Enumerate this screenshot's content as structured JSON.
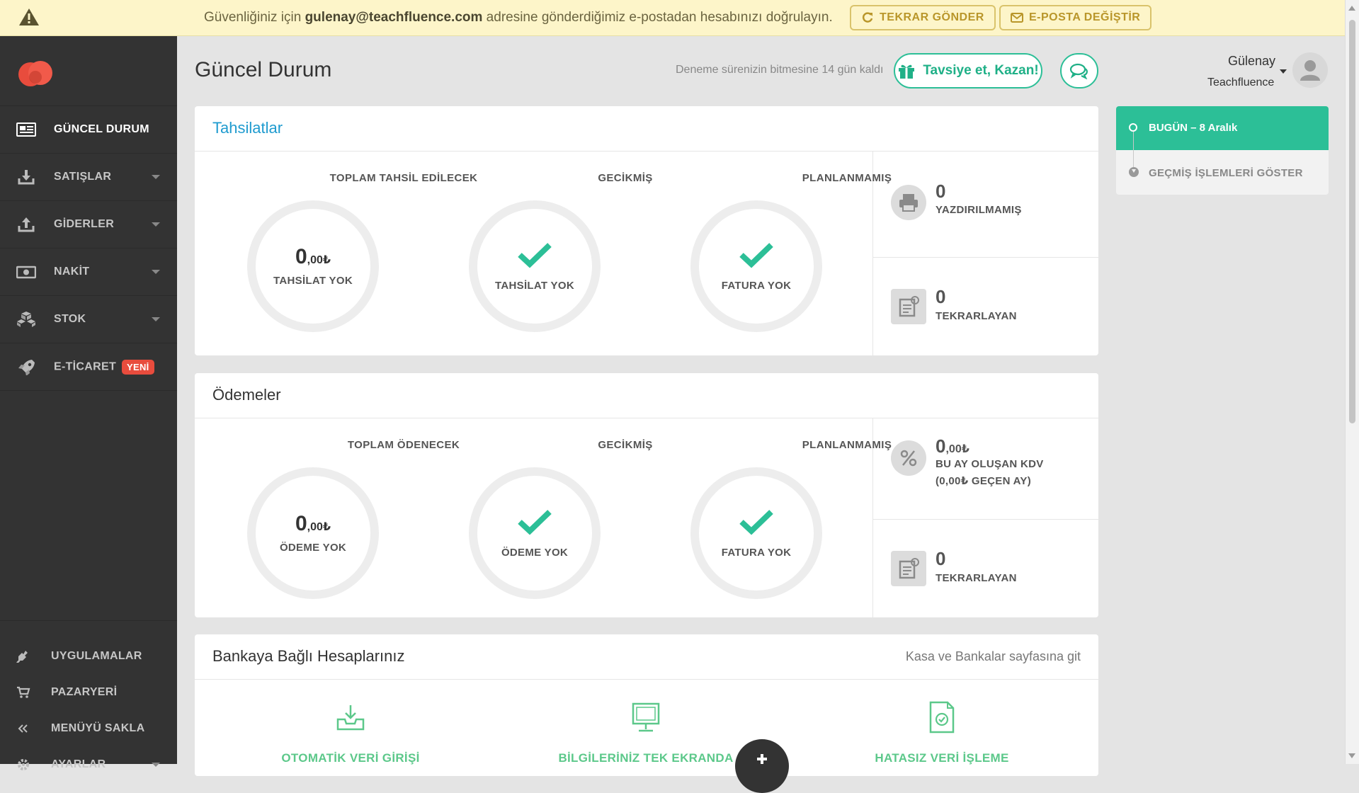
{
  "topbar": {
    "msg_pre": "Güvenliğiniz için ",
    "email": "gulenay@teachfluence.com",
    "msg_post": " adresine gönderdiğimiz e-postadan hesabınızı doğrulayın.",
    "resend_label": "TEKRAR GÖNDER",
    "change_email_label": "E-POSTA DEĞİŞTİR"
  },
  "sidebar": {
    "items": [
      {
        "label": "GÜNCEL DURUM",
        "icon": "newspaper-icon"
      },
      {
        "label": "SATIŞLAR",
        "icon": "download-tray-icon"
      },
      {
        "label": "GİDERLER",
        "icon": "upload-tray-icon"
      },
      {
        "label": "NAKİT",
        "icon": "banknote-icon"
      },
      {
        "label": "STOK",
        "icon": "boxes-icon"
      },
      {
        "label": "E-TİCARET",
        "icon": "rocket-icon",
        "badge": "YENİ"
      }
    ],
    "bottom": [
      {
        "label": "UYGULAMALAR",
        "icon": "plug-icon"
      },
      {
        "label": "PAZARYERİ",
        "icon": "cart-icon"
      },
      {
        "label": "MENÜYÜ SAKLA",
        "icon": "double-chevron-left-icon"
      },
      {
        "label": "AYARLAR",
        "icon": "gear-icon"
      }
    ]
  },
  "header": {
    "title": "Güncel Durum",
    "trial": "Deneme sürenizin bitmesine 14 gün kaldı",
    "refer_label": "Tavsiye et, Kazan!",
    "user_name": "Gülenay",
    "company": "Teachfluence"
  },
  "collections": {
    "title": "Tahsilatlar",
    "columns": [
      {
        "label": "TOPLAM TAHSİL EDİLECEK",
        "amount": "0",
        "decimal": ",00₺",
        "caption": "TAHSİLAT YOK"
      },
      {
        "label": "GECİKMİŞ",
        "caption": "TAHSİLAT YOK"
      },
      {
        "label": "PLANLANMAMIŞ",
        "caption": "FATURA YOK"
      }
    ],
    "side": [
      {
        "value": "0",
        "caption": "YAZDIRILMAMIŞ"
      },
      {
        "value": "0",
        "caption": "TEKRARLAYAN"
      }
    ]
  },
  "payments": {
    "title": "Ödemeler",
    "columns": [
      {
        "label": "TOPLAM ÖDENECEK",
        "amount": "0",
        "decimal": ",00₺",
        "caption": "ÖDEME YOK"
      },
      {
        "label": "GECİKMİŞ",
        "caption": "ÖDEME YOK"
      },
      {
        "label": "PLANLANMAMIŞ",
        "caption": "FATURA YOK"
      }
    ],
    "side": [
      {
        "value": "0",
        "decimal": ",00₺",
        "caption": "BU AY OLUŞAN KDV",
        "caption2": "(0,00₺ GEÇEN AY)"
      },
      {
        "value": "0",
        "caption": "TEKRARLAYAN"
      }
    ]
  },
  "bank": {
    "title": "Bankaya Bağlı Hesaplarınız",
    "link": "Kasa ve Bankalar sayfasına git",
    "features": [
      {
        "label": "OTOMATİK VERİ GİRİŞİ"
      },
      {
        "label": "BİLGİLERİNİZ TEK EKRANDA"
      },
      {
        "label": "HATASIZ VERİ İŞLEME"
      }
    ]
  },
  "timeline": {
    "today": "BUGÜN – 8 Aralık",
    "history": "GEÇMİŞ İŞLEMLERİ GÖSTER"
  },
  "colors": {
    "accent_green": "#2cbf97",
    "sidebar": "#333333",
    "warning_bar": "#fdf5c9",
    "badge_red": "#e84c3d"
  }
}
